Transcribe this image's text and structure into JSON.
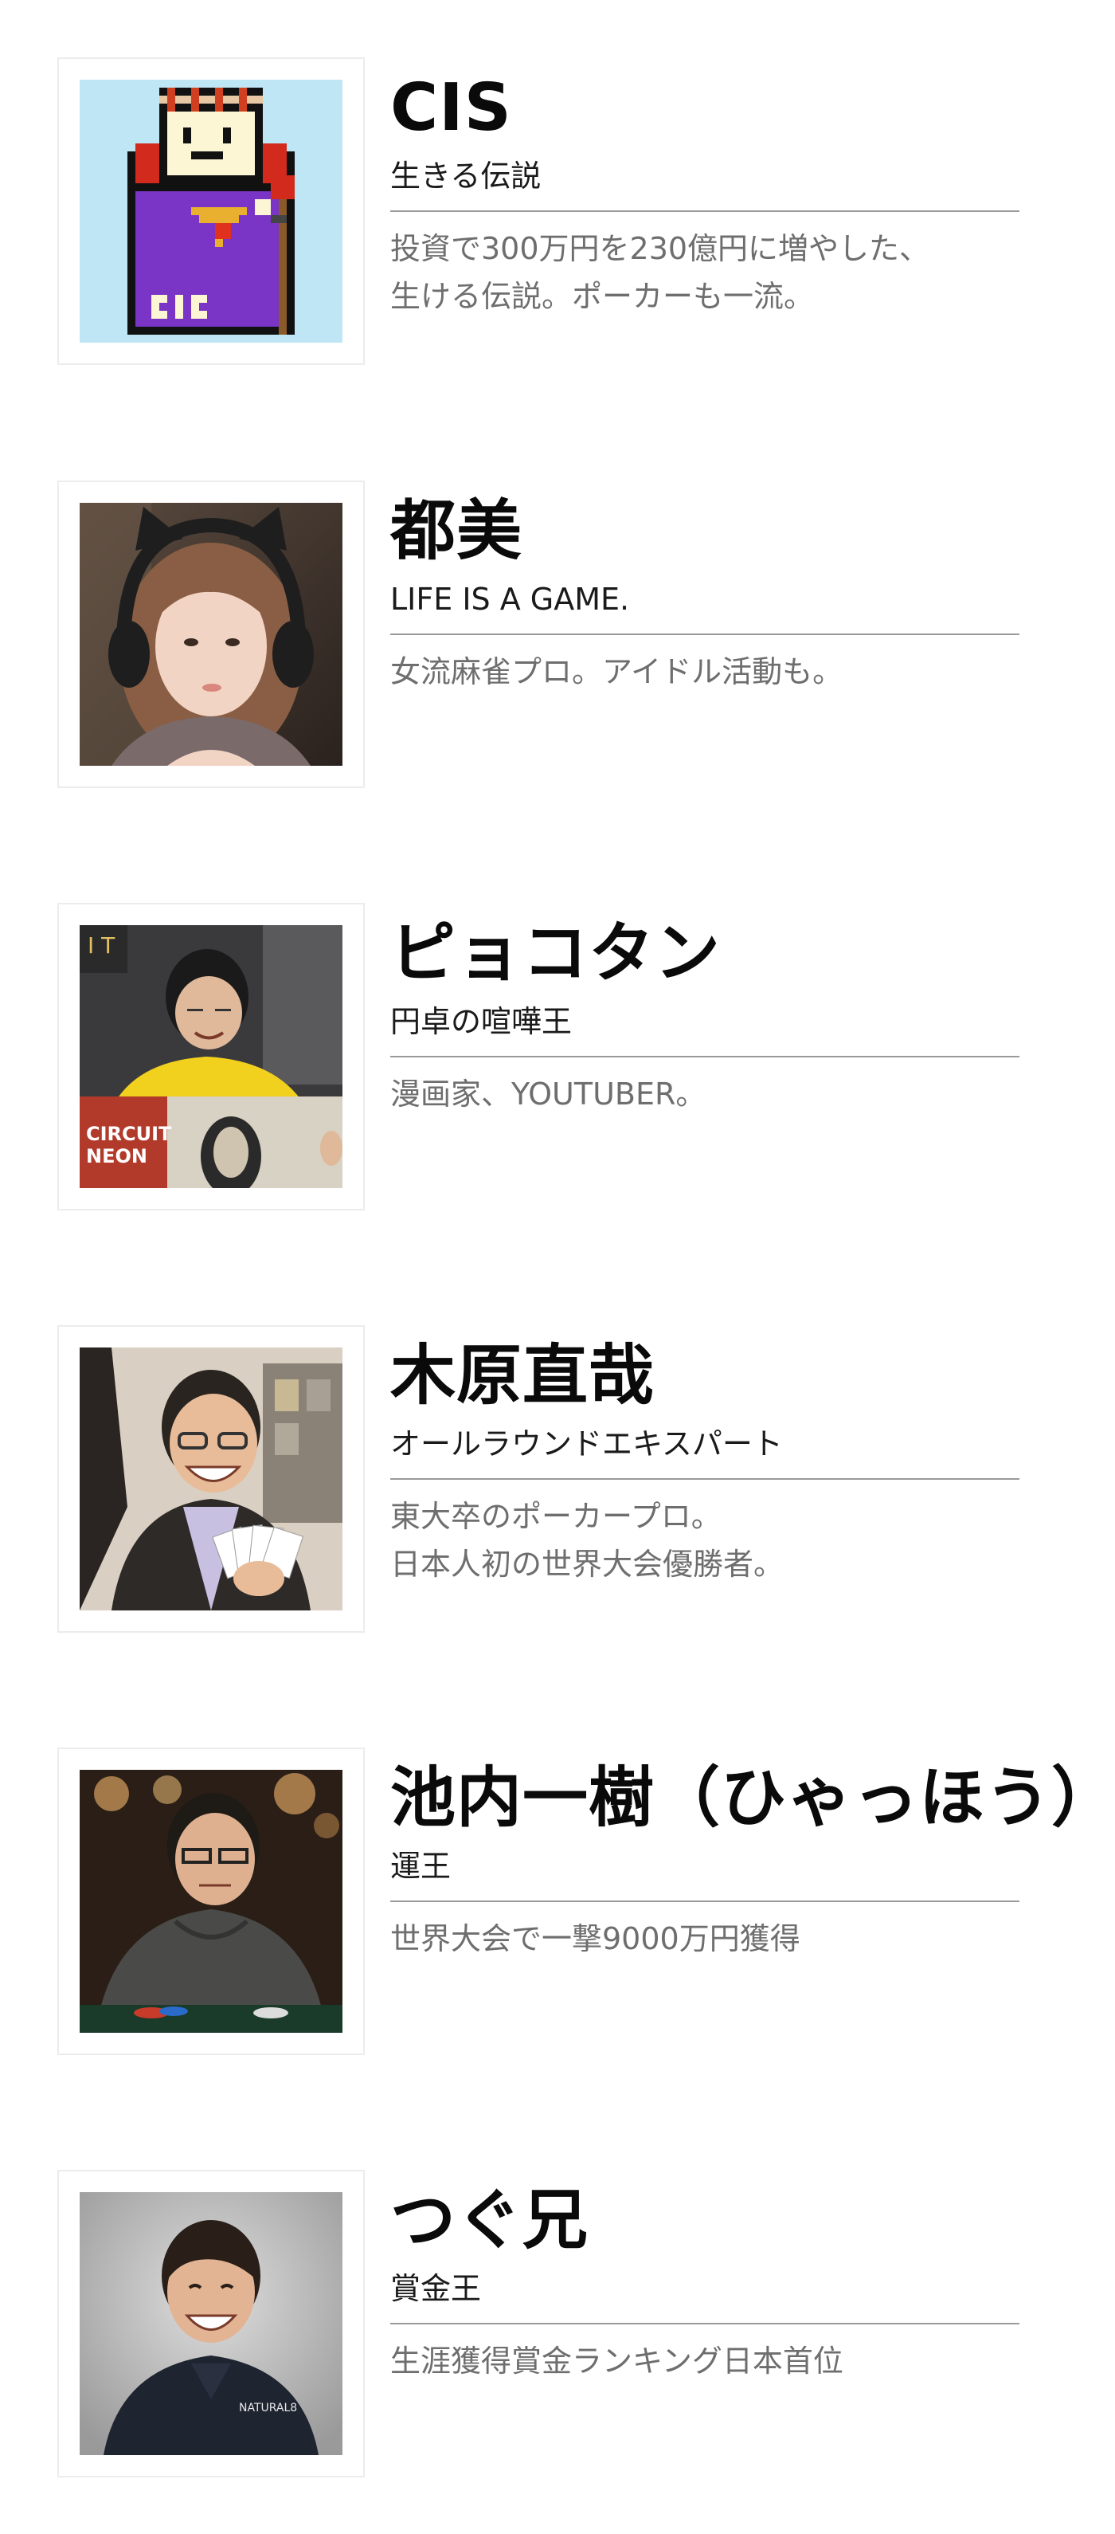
{
  "profiles": [
    {
      "name": "CIS",
      "title": "生きる伝説",
      "description": [
        "投資で300万円を230億円に増やした、",
        "生ける伝説。ポーカーも一流。"
      ],
      "photo_alt": "pixel-art king avatar"
    },
    {
      "name": "都美",
      "title": "LIFE IS A GAME.",
      "description": [
        "女流麻雀プロ。アイドル活動も。"
      ],
      "photo_alt": "woman with cat-ear headphones"
    },
    {
      "name": "ピョコタン",
      "title": "円卓の喧嘩王",
      "description": [
        "漫画家、YOUTUBER。"
      ],
      "photo_alt": "man in yellow shirt holding poster"
    },
    {
      "name": "木原直哉",
      "title": "オールラウンドエキスパート",
      "description": [
        "東大卒のポーカープロ。",
        "日本人初の世界大会優勝者。"
      ],
      "photo_alt": "man with glasses holding cards"
    },
    {
      "name": "池内一樹（ひゃっほう）",
      "title": "運王",
      "description": [
        "世界大会で一撃9000万円獲得"
      ],
      "photo_alt": "man in gray hoodie at poker table"
    },
    {
      "name": "つぐ兄",
      "title": "賞金王",
      "description": [
        "生涯獲得賞金ランキング日本首位"
      ],
      "photo_alt": "smiling man in dark jacket"
    }
  ],
  "photo_labels": {
    "cis_badge": "CIS",
    "circuit_text_1": "CIRCUIT",
    "circuit_text_2": "NEON",
    "jacket_logo": "NATURAL8"
  }
}
